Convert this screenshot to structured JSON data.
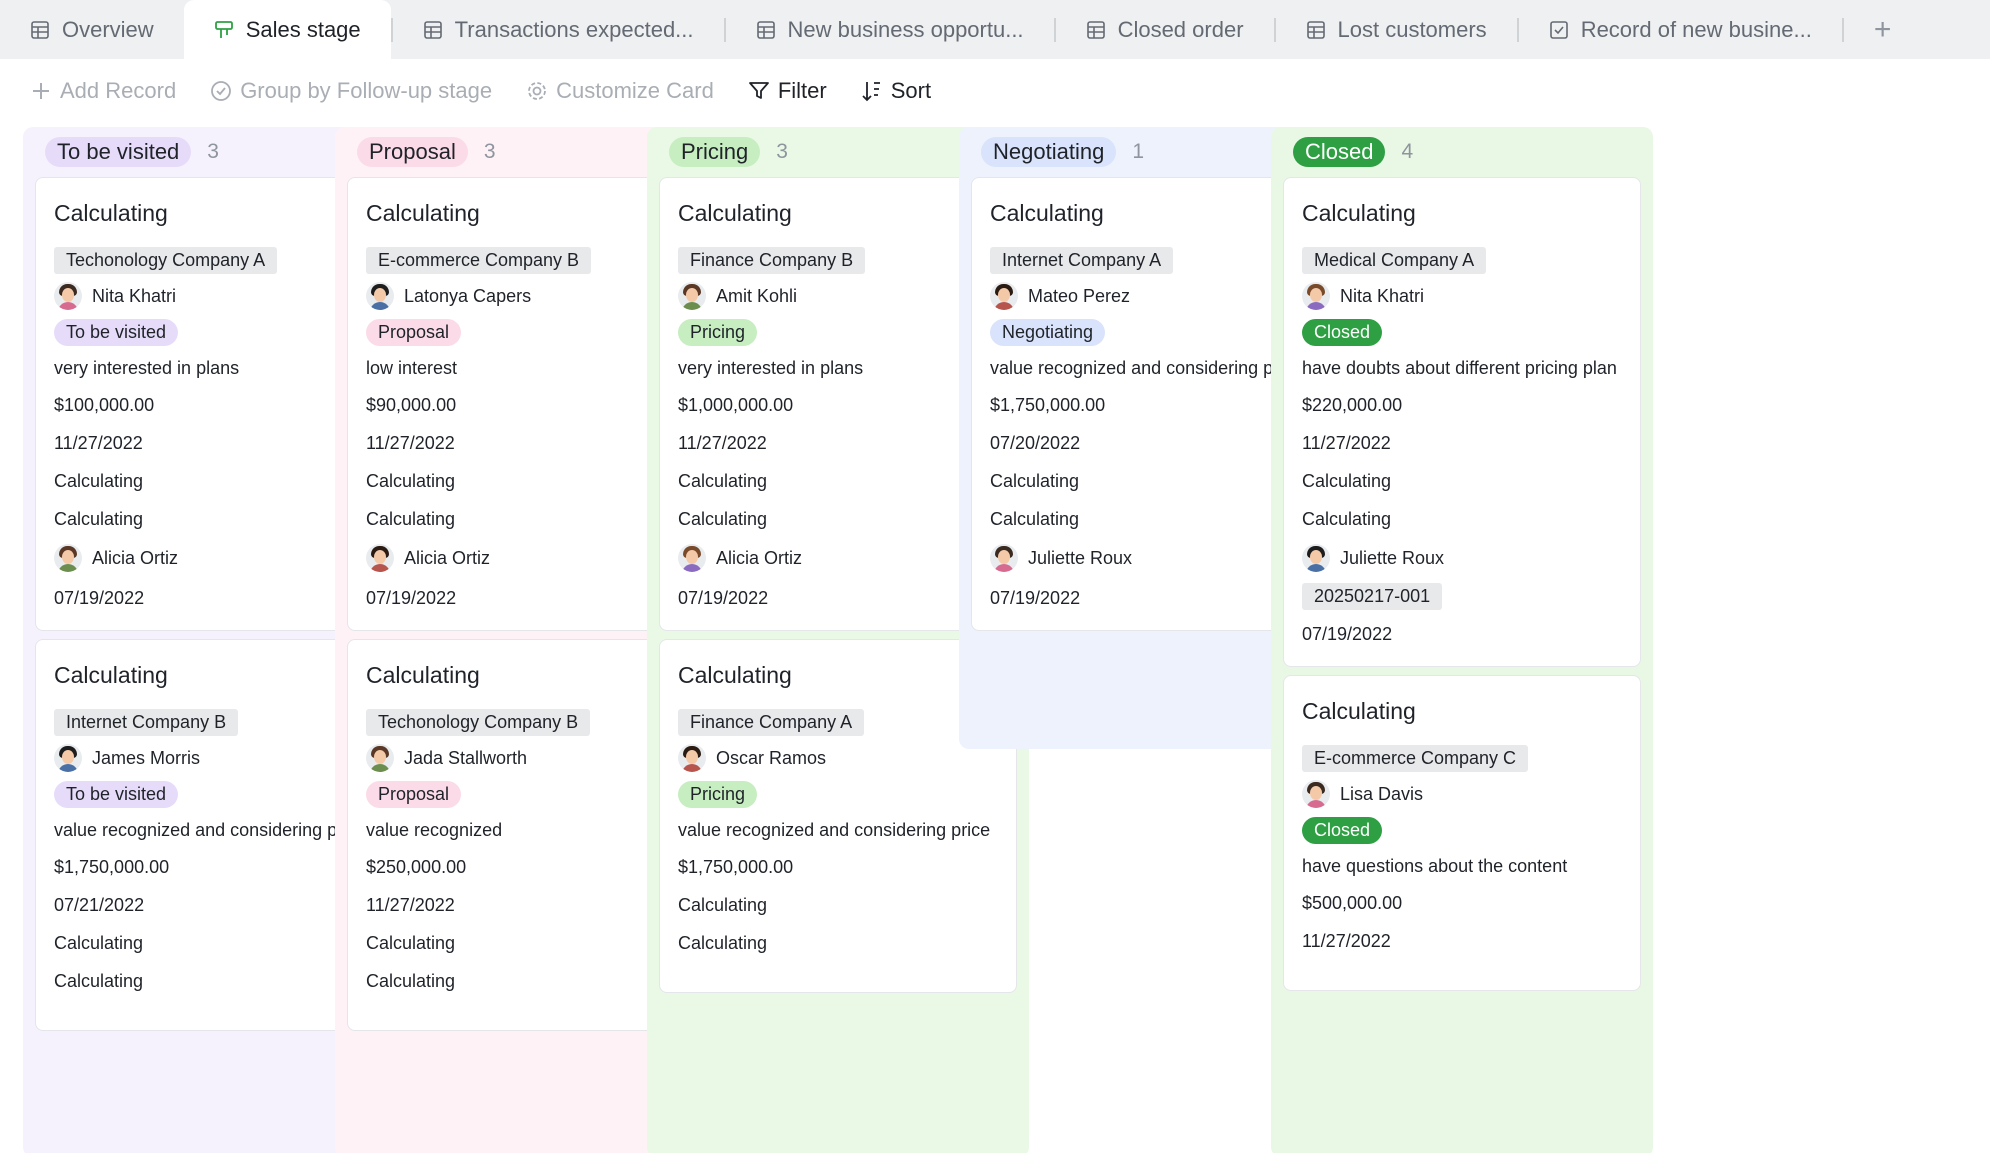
{
  "tabs": [
    {
      "label": "Overview",
      "icon": "table-icon",
      "active": false
    },
    {
      "label": "Sales stage",
      "icon": "kanban-icon",
      "active": true
    },
    {
      "label": "Transactions expected...",
      "icon": "table-icon",
      "active": false
    },
    {
      "label": "New business opportu...",
      "icon": "table-icon",
      "active": false
    },
    {
      "label": "Closed order",
      "icon": "table-icon",
      "active": false
    },
    {
      "label": "Lost customers",
      "icon": "table-icon",
      "active": false
    },
    {
      "label": "Record of new busine...",
      "icon": "form-icon",
      "active": false
    }
  ],
  "add_tab_icon": "plus-icon",
  "toolbar": {
    "add_record": "Add Record",
    "group_by": "Group by Follow-up stage",
    "customize_card": "Customize Card",
    "filter": "Filter",
    "sort": "Sort"
  },
  "colors": {
    "accent_green": "#34a853",
    "to_be_visited": {
      "bg": "#f6f2fd",
      "tag": "#e6dcfa",
      "tagtext": "#1f2329"
    },
    "proposal": {
      "bg": "#fef2f6",
      "tag": "#fcdbe8",
      "tagtext": "#1f2329"
    },
    "pricing": {
      "bg": "#eaf8e6",
      "tag": "#c6eec0",
      "tagtext": "#1f2329"
    },
    "negotiating": {
      "bg": "#eef2fd",
      "tag": "#d9e3fb",
      "tagtext": "#1f2329"
    },
    "closed": {
      "bg": "#e9f8e5",
      "tag": "#2ea043",
      "tagtext": "#ffffff"
    }
  },
  "columns": [
    {
      "key": "to_be_visited",
      "name": "To be visited",
      "count": "3",
      "cards": [
        {
          "title": "Calculating",
          "company": "Techonology Company A",
          "contact": "Nita Khatri",
          "stage": "To be visited",
          "note": "very interested in plans",
          "amount": "$100,000.00",
          "date": "11/27/2022",
          "calc1": "Calculating",
          "calc2": "Calculating",
          "owner": "Alicia Ortiz",
          "created": "07/19/2022"
        },
        {
          "title": "Calculating",
          "company": "Internet Company B",
          "contact": "James Morris",
          "stage": "To be visited",
          "note": "value recognized and considering price",
          "amount": "$1,750,000.00",
          "date": "07/21/2022",
          "calc1": "Calculating",
          "calc2": "Calculating",
          "owner": "",
          "created": ""
        }
      ]
    },
    {
      "key": "proposal",
      "name": "Proposal",
      "count": "3",
      "cards": [
        {
          "title": "Calculating",
          "company": "E-commerce Company B",
          "contact": "Latonya Capers",
          "stage": "Proposal",
          "note": "low interest",
          "amount": "$90,000.00",
          "date": "11/27/2022",
          "calc1": "Calculating",
          "calc2": "Calculating",
          "owner": "Alicia Ortiz",
          "created": "07/19/2022"
        },
        {
          "title": "Calculating",
          "company": "Techonology Company B",
          "contact": "Jada Stallworth",
          "stage": "Proposal",
          "note": "value recognized",
          "amount": "$250,000.00",
          "date": "11/27/2022",
          "calc1": "Calculating",
          "calc2": "Calculating",
          "owner": "",
          "created": ""
        }
      ]
    },
    {
      "key": "pricing",
      "name": "Pricing",
      "count": "3",
      "cards": [
        {
          "title": "Calculating",
          "company": "Finance Company B",
          "contact": "Amit Kohli",
          "stage": "Pricing",
          "note": "very interested in plans",
          "amount": "$1,000,000.00",
          "date": "11/27/2022",
          "calc1": "Calculating",
          "calc2": "Calculating",
          "owner": "Alicia Ortiz",
          "created": "07/19/2022"
        },
        {
          "title": "Calculating",
          "company": "Finance Company A",
          "contact": "Oscar Ramos",
          "stage": "Pricing",
          "note": "value recognized and considering price",
          "amount": "$1,750,000.00",
          "date": "",
          "calc1": "Calculating",
          "calc2": "Calculating",
          "owner": "",
          "created": ""
        }
      ]
    },
    {
      "key": "negotiating",
      "name": "Negotiating",
      "count": "1",
      "cards": [
        {
          "title": "Calculating",
          "company": "Internet Company A",
          "contact": "Mateo Perez",
          "stage": "Negotiating",
          "note": "value recognized and considering price",
          "amount": "$1,750,000.00",
          "date": "07/20/2022",
          "calc1": "Calculating",
          "calc2": "Calculating",
          "owner": "Juliette Roux",
          "created": "07/19/2022"
        }
      ]
    },
    {
      "key": "closed",
      "name": "Closed",
      "count": "4",
      "cards": [
        {
          "title": "Calculating",
          "company": "Medical Company A",
          "contact": "Nita Khatri",
          "stage": "Closed",
          "note": "have doubts about different pricing plan",
          "amount": "$220,000.00",
          "date": "11/27/2022",
          "calc1": "Calculating",
          "calc2": "Calculating",
          "owner": "Juliette Roux",
          "code": "20250217-001",
          "created": "07/19/2022"
        },
        {
          "title": "Calculating",
          "company": "E-commerce Company C",
          "contact": "Lisa Davis",
          "stage": "Closed",
          "note": "have questions about the content",
          "amount": "$500,000.00",
          "date": "11/27/2022",
          "calc1": "",
          "calc2": "",
          "owner": "",
          "created": ""
        }
      ]
    }
  ]
}
